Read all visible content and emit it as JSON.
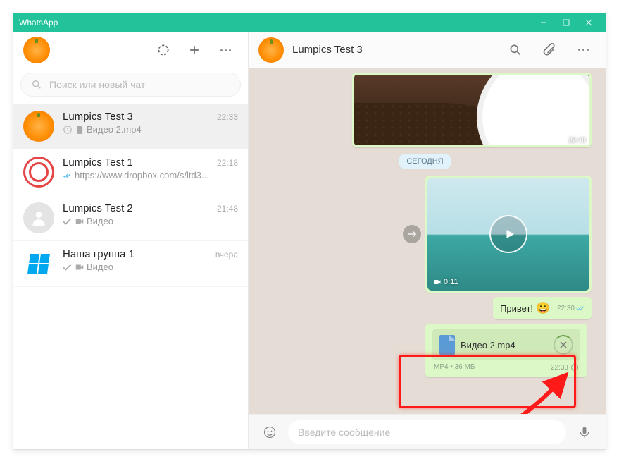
{
  "app": {
    "title": "WhatsApp"
  },
  "left_header": {},
  "search": {
    "placeholder": "Поиск или новый чат"
  },
  "chats": [
    {
      "name": "Lumpics Test 3",
      "time": "22:33",
      "preview": "Видео 2.mp4",
      "kind": "clock-doc",
      "avatar": "orange"
    },
    {
      "name": "Lumpics Test 1",
      "time": "22:18",
      "preview": "https://www.dropbox.com/s/ltd3...",
      "kind": "bluetick",
      "avatar": "redring"
    },
    {
      "name": "Lumpics Test 2",
      "time": "21:48",
      "preview": "Видео",
      "kind": "graytick-video",
      "avatar": "gray"
    },
    {
      "name": "Наша группа 1",
      "time": "вчера",
      "preview": "Видео",
      "kind": "graytick-video",
      "avatar": "windows"
    }
  ],
  "right_header": {
    "title": "Lumpics Test 3"
  },
  "chat": {
    "top_image_time": "22:48",
    "day_chip": "СЕГОДНЯ",
    "video": {
      "duration": "0:11"
    },
    "text_msg": {
      "text": "Привет!",
      "emoji": "😀",
      "time": "22:30"
    },
    "file_msg": {
      "name": "Видео 2.mp4",
      "meta_left": "MP4 • 36 МБ",
      "time": "22:33"
    }
  },
  "composer": {
    "placeholder": "Введите сообщение"
  }
}
